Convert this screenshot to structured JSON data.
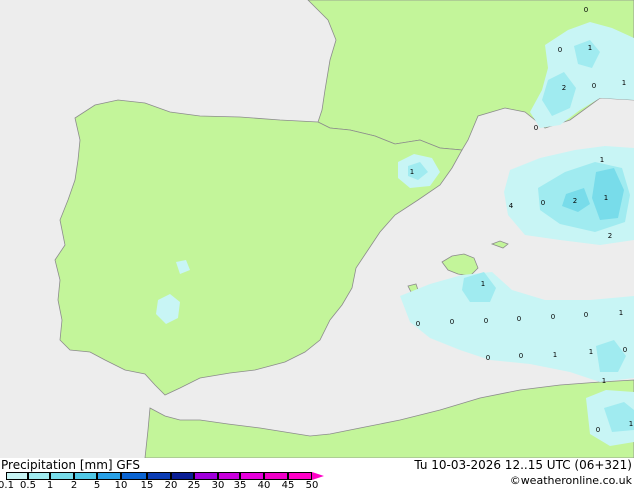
{
  "header": {
    "title": "Precipitation [mm] GFS",
    "valid_time": "Tu 10-03-2026 12..15 UTC (06+321)",
    "credit": "©weatheronline.co.uk"
  },
  "legend": {
    "ticks": [
      "0.1",
      "0.5",
      "1",
      "2",
      "5",
      "10",
      "15",
      "20",
      "25",
      "30",
      "35",
      "40",
      "45",
      "50"
    ],
    "colors": [
      "#c8f5f5",
      "#a0ebf0",
      "#78dcea",
      "#50c8e6",
      "#28a0e6",
      "#0a64d2",
      "#0a3cb4",
      "#0a1e96",
      "#a000dc",
      "#c800dc",
      "#e600dc",
      "#f000c8",
      "#ff00c8"
    ]
  },
  "map": {
    "land_color": "#c3f59a",
    "sea_color": "#ededed",
    "rain_colors": {
      "light": "#c8f5f5",
      "mid": "#a0ebf0",
      "high": "#78dcea"
    },
    "value_labels": [
      "0",
      "1",
      "0",
      "2",
      "0",
      "1",
      "0",
      "1",
      "2",
      "0",
      "1",
      "2",
      "4",
      "1",
      "1",
      "1",
      "0",
      "0",
      "0",
      "0",
      "0",
      "0",
      "1",
      "0",
      "0",
      "1",
      "0",
      "1",
      "0",
      "1"
    ]
  }
}
